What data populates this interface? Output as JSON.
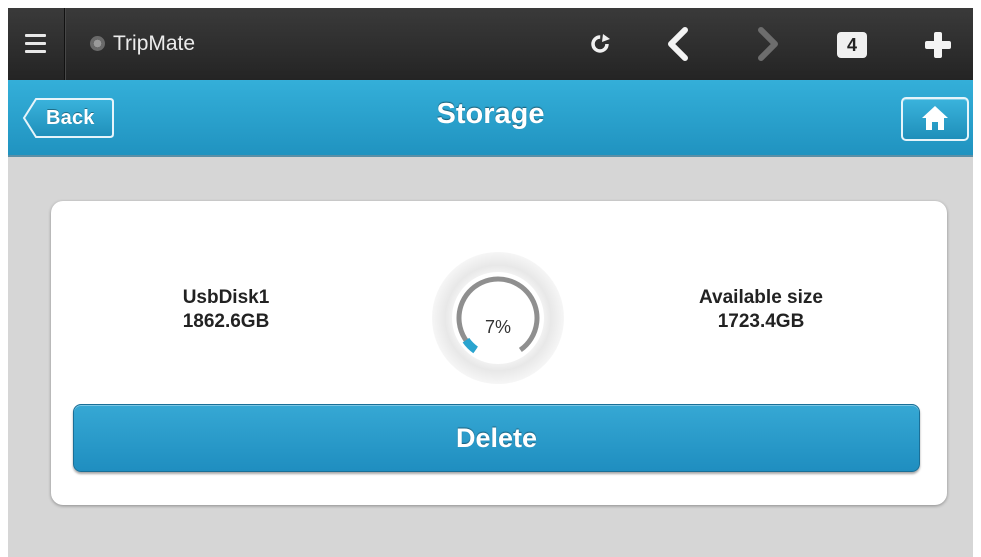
{
  "browser": {
    "site_name": "TripMate",
    "tab_count": "4",
    "icons": [
      "menu-icon",
      "site-icon",
      "reload-icon",
      "back-arrow-icon",
      "forward-arrow-icon",
      "tabs-icon",
      "plus-icon"
    ]
  },
  "header": {
    "back_label": "Back",
    "title": "Storage",
    "home_icon": "home-icon"
  },
  "storage": {
    "disk_name": "UsbDisk1",
    "disk_size": "1862.6GB",
    "usage_percent_label": "7%",
    "usage_fraction": 0.07,
    "available_label": "Available size",
    "available_size": "1723.4GB",
    "delete_label": "Delete"
  },
  "colors": {
    "header_blue": "#2aa4cf",
    "gauge_fill": "#2aa4cf",
    "browser_bar": "#2e2e2e",
    "background": "#d6d6d6"
  }
}
